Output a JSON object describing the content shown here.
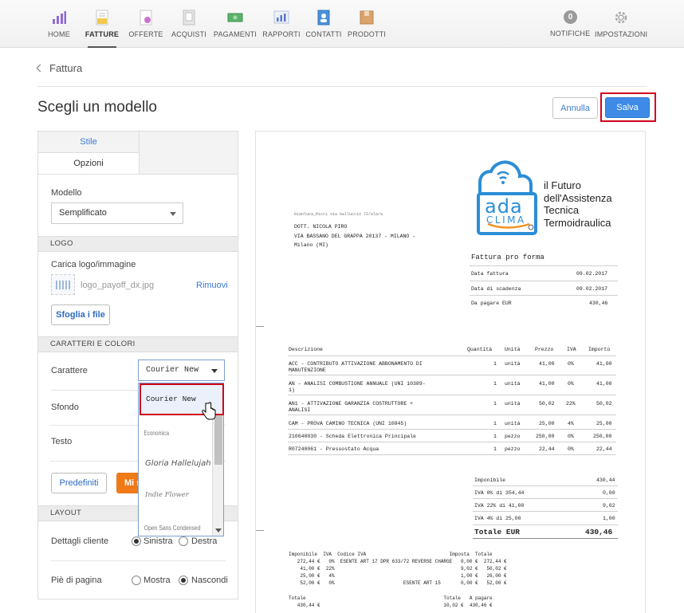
{
  "nav": {
    "items": [
      {
        "label": "HOME",
        "icon": "bar-chart-icon"
      },
      {
        "label": "FATTURE",
        "icon": "invoice-icon",
        "active": true
      },
      {
        "label": "OFFERTE",
        "icon": "offer-icon"
      },
      {
        "label": "ACQUISTI",
        "icon": "purchase-icon"
      },
      {
        "label": "PAGAMENTI",
        "icon": "banknote-icon"
      },
      {
        "label": "RAPPORTI",
        "icon": "report-icon"
      },
      {
        "label": "CONTATTI",
        "icon": "contacts-icon"
      },
      {
        "label": "PRODOTTI",
        "icon": "product-icon"
      }
    ],
    "notifications": {
      "label": "NOTIFICHE",
      "count": "0"
    },
    "settings": {
      "label": "IMPOSTAZIONI",
      "icon": "gear-icon"
    }
  },
  "breadcrumb": {
    "back_label": "Fattura"
  },
  "page": {
    "title": "Scegli un modello"
  },
  "actions": {
    "cancel_label": "Annulla",
    "save_label": "Salva"
  },
  "panel": {
    "tabs": {
      "stile": "Stile",
      "opzioni": "Opzioni"
    },
    "modello": {
      "label": "Modello",
      "value": "Semplificato"
    },
    "logo": {
      "section": "LOGO",
      "label": "Carica logo/immagine",
      "filename": "logo_payoff_dx.jpg",
      "remove": "Rimuovi",
      "browse": "Sfoglia i file"
    },
    "fonts": {
      "section": "CARATTERI E COLORI",
      "carattere_label": "Carattere",
      "carattere_value": "Courier New",
      "sfondo_label": "Sfondo",
      "testo_label": "Testo",
      "options": [
        "Courier New",
        "Economica",
        "Gloria Hallelujah",
        "Indie Flower",
        "Open Sans Condensed"
      ],
      "predefiniti": "Predefiniti",
      "custom": "Mi s"
    },
    "layout": {
      "section": "LAYOUT",
      "cliente_label": "Dettagli cliente",
      "cliente_opt1": "Sinistra",
      "cliente_opt2": "Destra",
      "piede_label": "Piè di pagina",
      "piede_opt1": "Mostra",
      "piede_opt2": "Nascondi"
    }
  },
  "invoice": {
    "logo_word1": "ada",
    "logo_word2": "CLIMA",
    "tagline": [
      "il Futuro",
      "dell'Assistenza",
      "Tecnica",
      "Termoidraulica"
    ],
    "sender": "Gianluca_Ricci via Galluccio 72/ala/a",
    "client": [
      "DOTT. NICOLA PIRO",
      "VIA BASSANO DEL GRAPPA 20137 - MILANO -",
      "Milano (MI)"
    ],
    "doc_title": "Fattura pro forma",
    "meta": [
      {
        "k": "Data fattura",
        "v": "09.02.2017"
      },
      {
        "k": "Data di scadenza",
        "v": "09.02.2017"
      },
      {
        "k": "Da pagare EUR",
        "v": "430,46"
      }
    ],
    "headers": [
      "Descrizione",
      "Quantità",
      "Unità",
      "Prezzo",
      "IVA",
      "Importo"
    ],
    "lines": [
      {
        "d1": "ACC - CONTRIBUTO ATTIVAZIONE ABBONAMENTO DI",
        "d2": "MANUTENZIONE",
        "q": "1",
        "u": "unità",
        "p": "41,00",
        "i": "0%",
        "t": "41,00"
      },
      {
        "d1": "AN - ANALISI COMBUSTIONE ANNUALE (UNI 10389-",
        "d2": "1)",
        "q": "1",
        "u": "unità",
        "p": "41,00",
        "i": "0%",
        "t": "41,00"
      },
      {
        "d1": "AN1 - ATTIVAZIONE GARANZIA COSTRUTTORE +",
        "d2": "ANALISI",
        "q": "1",
        "u": "unità",
        "p": "50,02",
        "i": "22%",
        "t": "50,02"
      },
      {
        "d1": "CAM - PROVA CAMINO TECNICA (UNI 10845)",
        "d2": "",
        "q": "1",
        "u": "unità",
        "p": "25,00",
        "i": "4%",
        "t": "25,00"
      },
      {
        "d1": "210648030 - Scheda Elettronica Principale",
        "d2": "",
        "q": "1",
        "u": "pezzo",
        "p": "250,00",
        "i": "0%",
        "t": "250,00"
      },
      {
        "d1": "R07240061 - Pressostato Acqua",
        "d2": "",
        "q": "1",
        "u": "pezzo",
        "p": "22,44",
        "i": "0%",
        "t": "22,44"
      }
    ],
    "totals": [
      {
        "k": "Imponibile",
        "v": "430,44"
      },
      {
        "k": "IVA 0% di 354,44",
        "v": "0,00"
      },
      {
        "k": "IVA 22% di 41,00",
        "v": "9,02"
      },
      {
        "k": "IVA 4% di 25,00",
        "v": "1,00"
      }
    ],
    "grand_total_label": "Totale EUR",
    "grand_total_value": "430,46",
    "vat_header": "Imponibile  IVA  Codice IVA                             Imposta  Totale",
    "vat_rows": [
      "   272,44 €   0%  ESENTE ART 17 DPR 633/72 REVERSE CHARGE   0,00 €  272,44 €",
      "    41,00 €  22%                                            9,02 €   50,02 €",
      "    25,00 €   4%                                            1,00 €   26,00 €",
      "    52,00 €   0%                        ESENTE ART 15       0,00 €   52,00 €"
    ],
    "sum_header": "Totale                                                Totale   A pagare",
    "sum_row": "   430,44 €                                           10,02 €  430,46 €"
  }
}
